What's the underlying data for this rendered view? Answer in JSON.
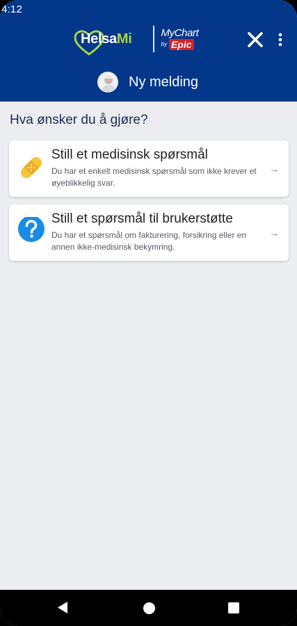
{
  "status_bar": {
    "time": "4:12"
  },
  "header": {
    "brand_primary": "Helsa",
    "brand_primary_accent": "Mi",
    "brand_secondary": "MyChart",
    "brand_secondary_by": "by",
    "brand_secondary_epic": "Epic",
    "title": "Ny melding"
  },
  "content": {
    "question": "Hva ønsker du å gjøre?",
    "options": [
      {
        "title": "Still et medisinsk spørsmål",
        "description": "Du har et enkelt medisinsk spørsmål som ikke krever et øyeblikkelig svar.",
        "icon": "bandage-icon",
        "arrow": "→"
      },
      {
        "title": "Still et spørsmål til brukerstøtte",
        "description": "Du har et spørsmål om fakturering, forsikring eller en annen ikke-medisinsk bekymring.",
        "icon": "question-circle-icon",
        "arrow": "→"
      }
    ]
  },
  "colors": {
    "header_bg": "#03378a",
    "accent_green": "#a6d24a",
    "epic_red": "#d91f26",
    "content_bg": "#ebedf1",
    "question_icon": "#1a8ce6",
    "bandage": "#f6c33b"
  }
}
